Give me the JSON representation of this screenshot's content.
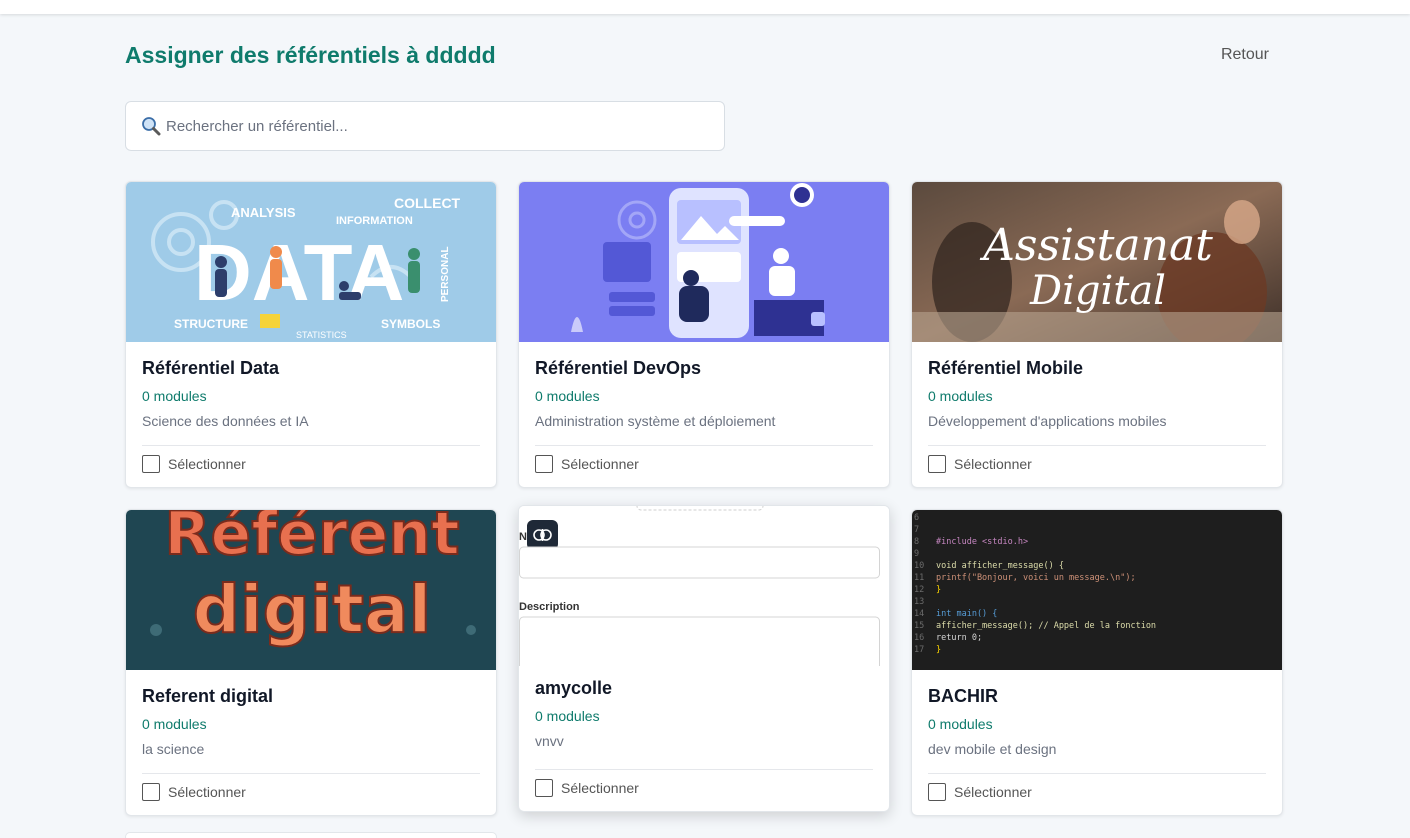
{
  "header": {
    "title": "Assigner des référentiels à ddddd",
    "back_label": "Retour"
  },
  "search": {
    "placeholder": "Rechercher un référentiel..."
  },
  "cards": [
    {
      "title": "Référentiel Data",
      "modules": "0 modules",
      "description": "Science des données et IA",
      "select_label": "Sélectionner",
      "image_text": [
        "ANALYSIS",
        "COLLECT",
        "INFORMATION",
        "DATA",
        "STRUCTURE",
        "STATISTICS",
        "SYMBOLS",
        "PERSONAL"
      ]
    },
    {
      "title": "Référentiel DevOps",
      "modules": "0 modules",
      "description": "Administration système et déploiement",
      "select_label": "Sélectionner"
    },
    {
      "title": "Référentiel Mobile",
      "modules": "0 modules",
      "description": "Développement d'applications mobiles",
      "select_label": "Sélectionner",
      "image_text": [
        "Assistanat",
        "Digital"
      ]
    },
    {
      "title": "Referent digital",
      "modules": "0 modules",
      "description": "la science",
      "select_label": "Sélectionner",
      "image_text": [
        "Référent",
        "digital"
      ]
    },
    {
      "title": "amycolle",
      "modules": "0 modules",
      "description": "vnvv",
      "select_label": "Sélectionner",
      "image_text": [
        "N",
        "Description"
      ]
    },
    {
      "title": "BACHIR",
      "modules": "0 modules",
      "description": "dev mobile et design",
      "select_label": "Sélectionner",
      "image_code": [
        "#include <stdio.h>",
        "",
        "void afficher_message() {",
        "    printf(\"Bonjour, voici un message.\\n\");",
        "}",
        "",
        "int main() {",
        "    afficher_message(); // Appel de la fonction",
        "    return 0;",
        "}"
      ]
    }
  ],
  "colors": {
    "accent": "#0f7b6c",
    "background": "#f4f7fa"
  }
}
